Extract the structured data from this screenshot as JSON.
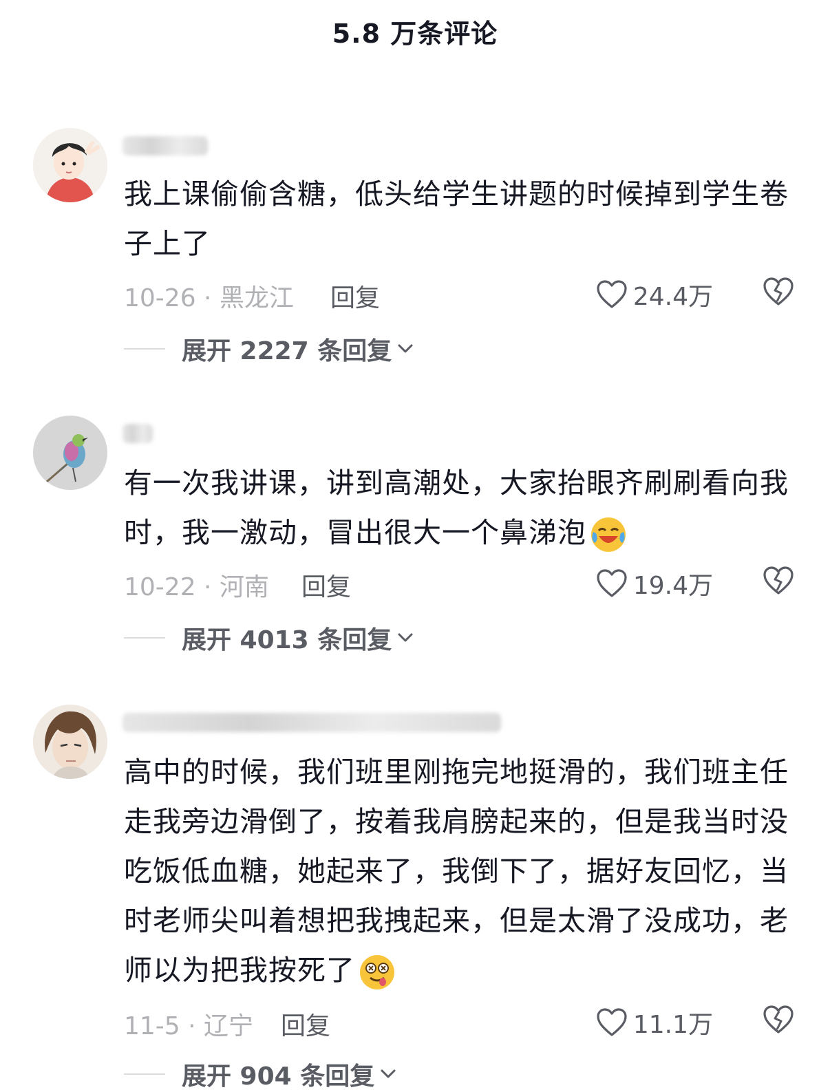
{
  "header": {
    "title": "5.8 万条评论"
  },
  "comments": [
    {
      "text": "我上课偷偷含糖，低头给学生讲题的时候掉到学生卷子上了",
      "date_location": "10-26 · 黑龙江",
      "reply_label": "回复",
      "likes": "24.4万",
      "expand_label": "展开 2227 条回复",
      "avatar_icon": "boy-cartoon-avatar"
    },
    {
      "text": "有一次我讲课，讲到高潮处，大家抬眼齐刷刷看向我时，我一激动，冒出很大一个鼻涕泡",
      "date_location": "10-22 · 河南",
      "reply_label": "回复",
      "likes": "19.4万",
      "expand_label": "展开 4013 条回复",
      "avatar_icon": "bird-avatar",
      "emoji_icon": "laughing-crying-emoji"
    },
    {
      "text": "高中的时候，我们班里刚拖完地挺滑的，我们班主任走我旁边滑倒了，按着我肩膀起来的，但是我当时没吃饭低血糖，她起来了，我倒下了，据好友回忆，当时老师尖叫着想把我拽起来，但是太滑了没成功，老师以为把我按死了",
      "date_location": "11-5 · 辽宁",
      "reply_label": "回复",
      "likes": "11.1万",
      "expand_label": "展开 904 条回复",
      "avatar_icon": "anime-man-avatar",
      "emoji_icon": "dizzy-face-emoji"
    }
  ],
  "icons": {
    "like": "heart-outline-icon",
    "dislike": "broken-heart-icon",
    "expand": "chevron-down-icon"
  },
  "colors": {
    "text_primary": "#161823",
    "text_secondary": "#5a5c64",
    "text_muted": "#b0b1b5"
  }
}
